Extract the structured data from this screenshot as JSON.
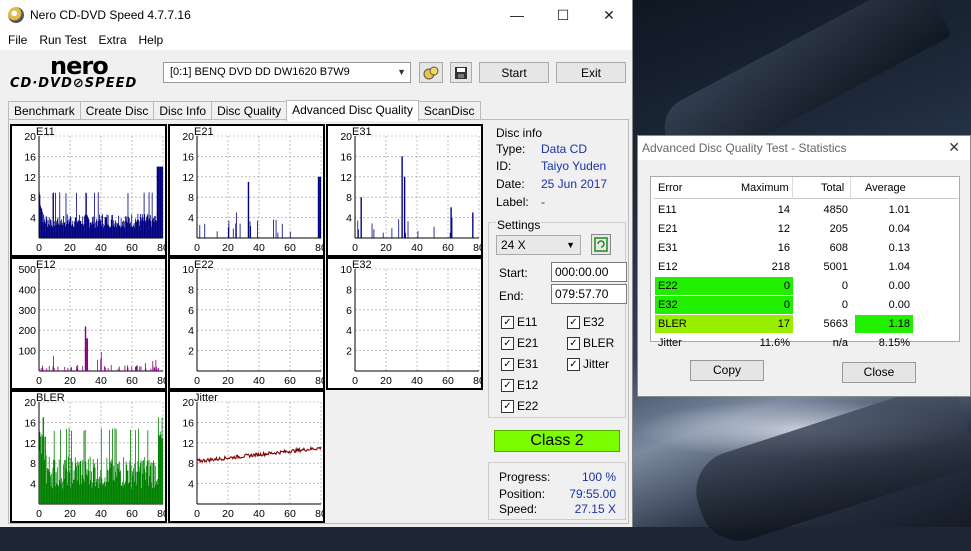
{
  "window": {
    "title": "Nero CD-DVD Speed 4.7.7.16",
    "min": "—",
    "max": "☐",
    "close": "✕"
  },
  "menu": [
    "File",
    "Run Test",
    "Extra",
    "Help"
  ],
  "logo": {
    "line1": "nero",
    "line2": "CD·DVD⊘SPEED"
  },
  "toolbar": {
    "drive": "[0:1]   BENQ DVD DD DW1620 B7W9",
    "start": "Start",
    "exit": "Exit"
  },
  "tabs": [
    "Benchmark",
    "Create Disc",
    "Disc Info",
    "Disc Quality",
    "Advanced Disc Quality",
    "ScanDisc"
  ],
  "active_tab": 4,
  "disc_info": {
    "heading": "Disc info",
    "type_label": "Type:",
    "type": "Data CD",
    "id_label": "ID:",
    "id": "Taiyo Yuden",
    "date_label": "Date:",
    "date": "25 Jun 2017",
    "label_label": "Label:",
    "label": "-"
  },
  "settings": {
    "heading": "Settings",
    "speed": "24 X",
    "start_label": "Start:",
    "start": "000:00.00",
    "end_label": "End:",
    "end": "079:57.70"
  },
  "checks": [
    {
      "label": "E11",
      "checked": true
    },
    {
      "label": "E32",
      "checked": true
    },
    {
      "label": "E21",
      "checked": true
    },
    {
      "label": "BLER",
      "checked": true
    },
    {
      "label": "E31",
      "checked": true
    },
    {
      "label": "Jitter",
      "checked": true
    },
    {
      "label": "E12",
      "checked": true
    },
    {
      "label": "E22",
      "checked": true
    }
  ],
  "class_result": "Class 2",
  "progress": {
    "progress_label": "Progress:",
    "progress": "100 %",
    "position_label": "Position:",
    "position": "79:55.00",
    "speed_label": "Speed:",
    "speed": "27.15 X"
  },
  "chart_data": [
    {
      "name": "E11",
      "type": "bar",
      "xlim": [
        0,
        80
      ],
      "ylim": [
        0,
        20
      ],
      "yticks": [
        4,
        8,
        12,
        16,
        20
      ],
      "xticks": [
        0,
        20,
        40,
        60,
        80
      ],
      "color": "#000080",
      "profile": "e11"
    },
    {
      "name": "E21",
      "type": "bar",
      "xlim": [
        0,
        80
      ],
      "ylim": [
        0,
        20
      ],
      "yticks": [
        4,
        8,
        12,
        16,
        20
      ],
      "xticks": [
        0,
        20,
        40,
        60,
        80
      ],
      "color": "#000080",
      "profile": "e21"
    },
    {
      "name": "E31",
      "type": "bar",
      "xlim": [
        0,
        80
      ],
      "ylim": [
        0,
        20
      ],
      "yticks": [
        4,
        8,
        12,
        16,
        20
      ],
      "xticks": [
        0,
        20,
        40,
        60,
        80
      ],
      "color": "#000080",
      "profile": "e31"
    },
    {
      "name": "E12",
      "type": "bar",
      "xlim": [
        0,
        80
      ],
      "ylim": [
        0,
        500
      ],
      "yticks": [
        100,
        200,
        300,
        400,
        500
      ],
      "xticks": [
        0,
        20,
        40,
        60,
        80
      ],
      "color": "#800080",
      "profile": "e12"
    },
    {
      "name": "E22",
      "type": "bar",
      "xlim": [
        0,
        80
      ],
      "ylim": [
        0,
        10
      ],
      "yticks": [
        2,
        4,
        6,
        8,
        10
      ],
      "xticks": [
        0,
        20,
        40,
        60,
        80
      ],
      "color": "#000080",
      "profile": "none"
    },
    {
      "name": "E32",
      "type": "bar",
      "xlim": [
        0,
        80
      ],
      "ylim": [
        0,
        10
      ],
      "yticks": [
        2,
        4,
        6,
        8,
        10
      ],
      "xticks": [
        0,
        20,
        40,
        60,
        80
      ],
      "color": "#000080",
      "profile": "none"
    },
    {
      "name": "BLER",
      "type": "bar",
      "xlim": [
        0,
        80
      ],
      "ylim": [
        0,
        20
      ],
      "yticks": [
        4,
        8,
        12,
        16,
        20
      ],
      "xticks": [
        0,
        20,
        40,
        60,
        80
      ],
      "color": "#008000",
      "profile": "bler"
    },
    {
      "name": "Jitter",
      "type": "line",
      "xlim": [
        0,
        80
      ],
      "ylim": [
        0,
        20
      ],
      "yticks": [
        4,
        8,
        12,
        16,
        20
      ],
      "xticks": [
        0,
        20,
        40,
        60,
        80
      ],
      "color": "#800000",
      "profile": "jitter"
    }
  ],
  "stats": {
    "title": "Advanced Disc Quality Test - Statistics",
    "close": "✕",
    "headers": [
      "Error",
      "Maximum",
      "Total",
      "Average"
    ],
    "rows": [
      {
        "error": "E11",
        "max": "14",
        "total": "4850",
        "avg": "1.01",
        "hl_err": "",
        "hl_avg": ""
      },
      {
        "error": "E21",
        "max": "12",
        "total": "205",
        "avg": "0.04",
        "hl_err": "",
        "hl_avg": ""
      },
      {
        "error": "E31",
        "max": "16",
        "total": "608",
        "avg": "0.13",
        "hl_err": "",
        "hl_avg": ""
      },
      {
        "error": "E12",
        "max": "218",
        "total": "5001",
        "avg": "1.04",
        "hl_err": "",
        "hl_avg": ""
      },
      {
        "error": "E22",
        "max": "0",
        "total": "0",
        "avg": "0.00",
        "hl_err": "#22ee00",
        "hl_avg": ""
      },
      {
        "error": "E32",
        "max": "0",
        "total": "0",
        "avg": "0.00",
        "hl_err": "#22ee00",
        "hl_avg": ""
      },
      {
        "error": "BLER",
        "max": "17",
        "total": "5663",
        "avg": "1.18",
        "hl_err": "#99ee00",
        "hl_avg": "#22ee00"
      },
      {
        "error": "Jitter",
        "max": "11.6%",
        "total": "n/a",
        "avg": "8.15%",
        "hl_err": "",
        "hl_avg": ""
      }
    ],
    "copy": "Copy",
    "close_btn": "Close"
  }
}
